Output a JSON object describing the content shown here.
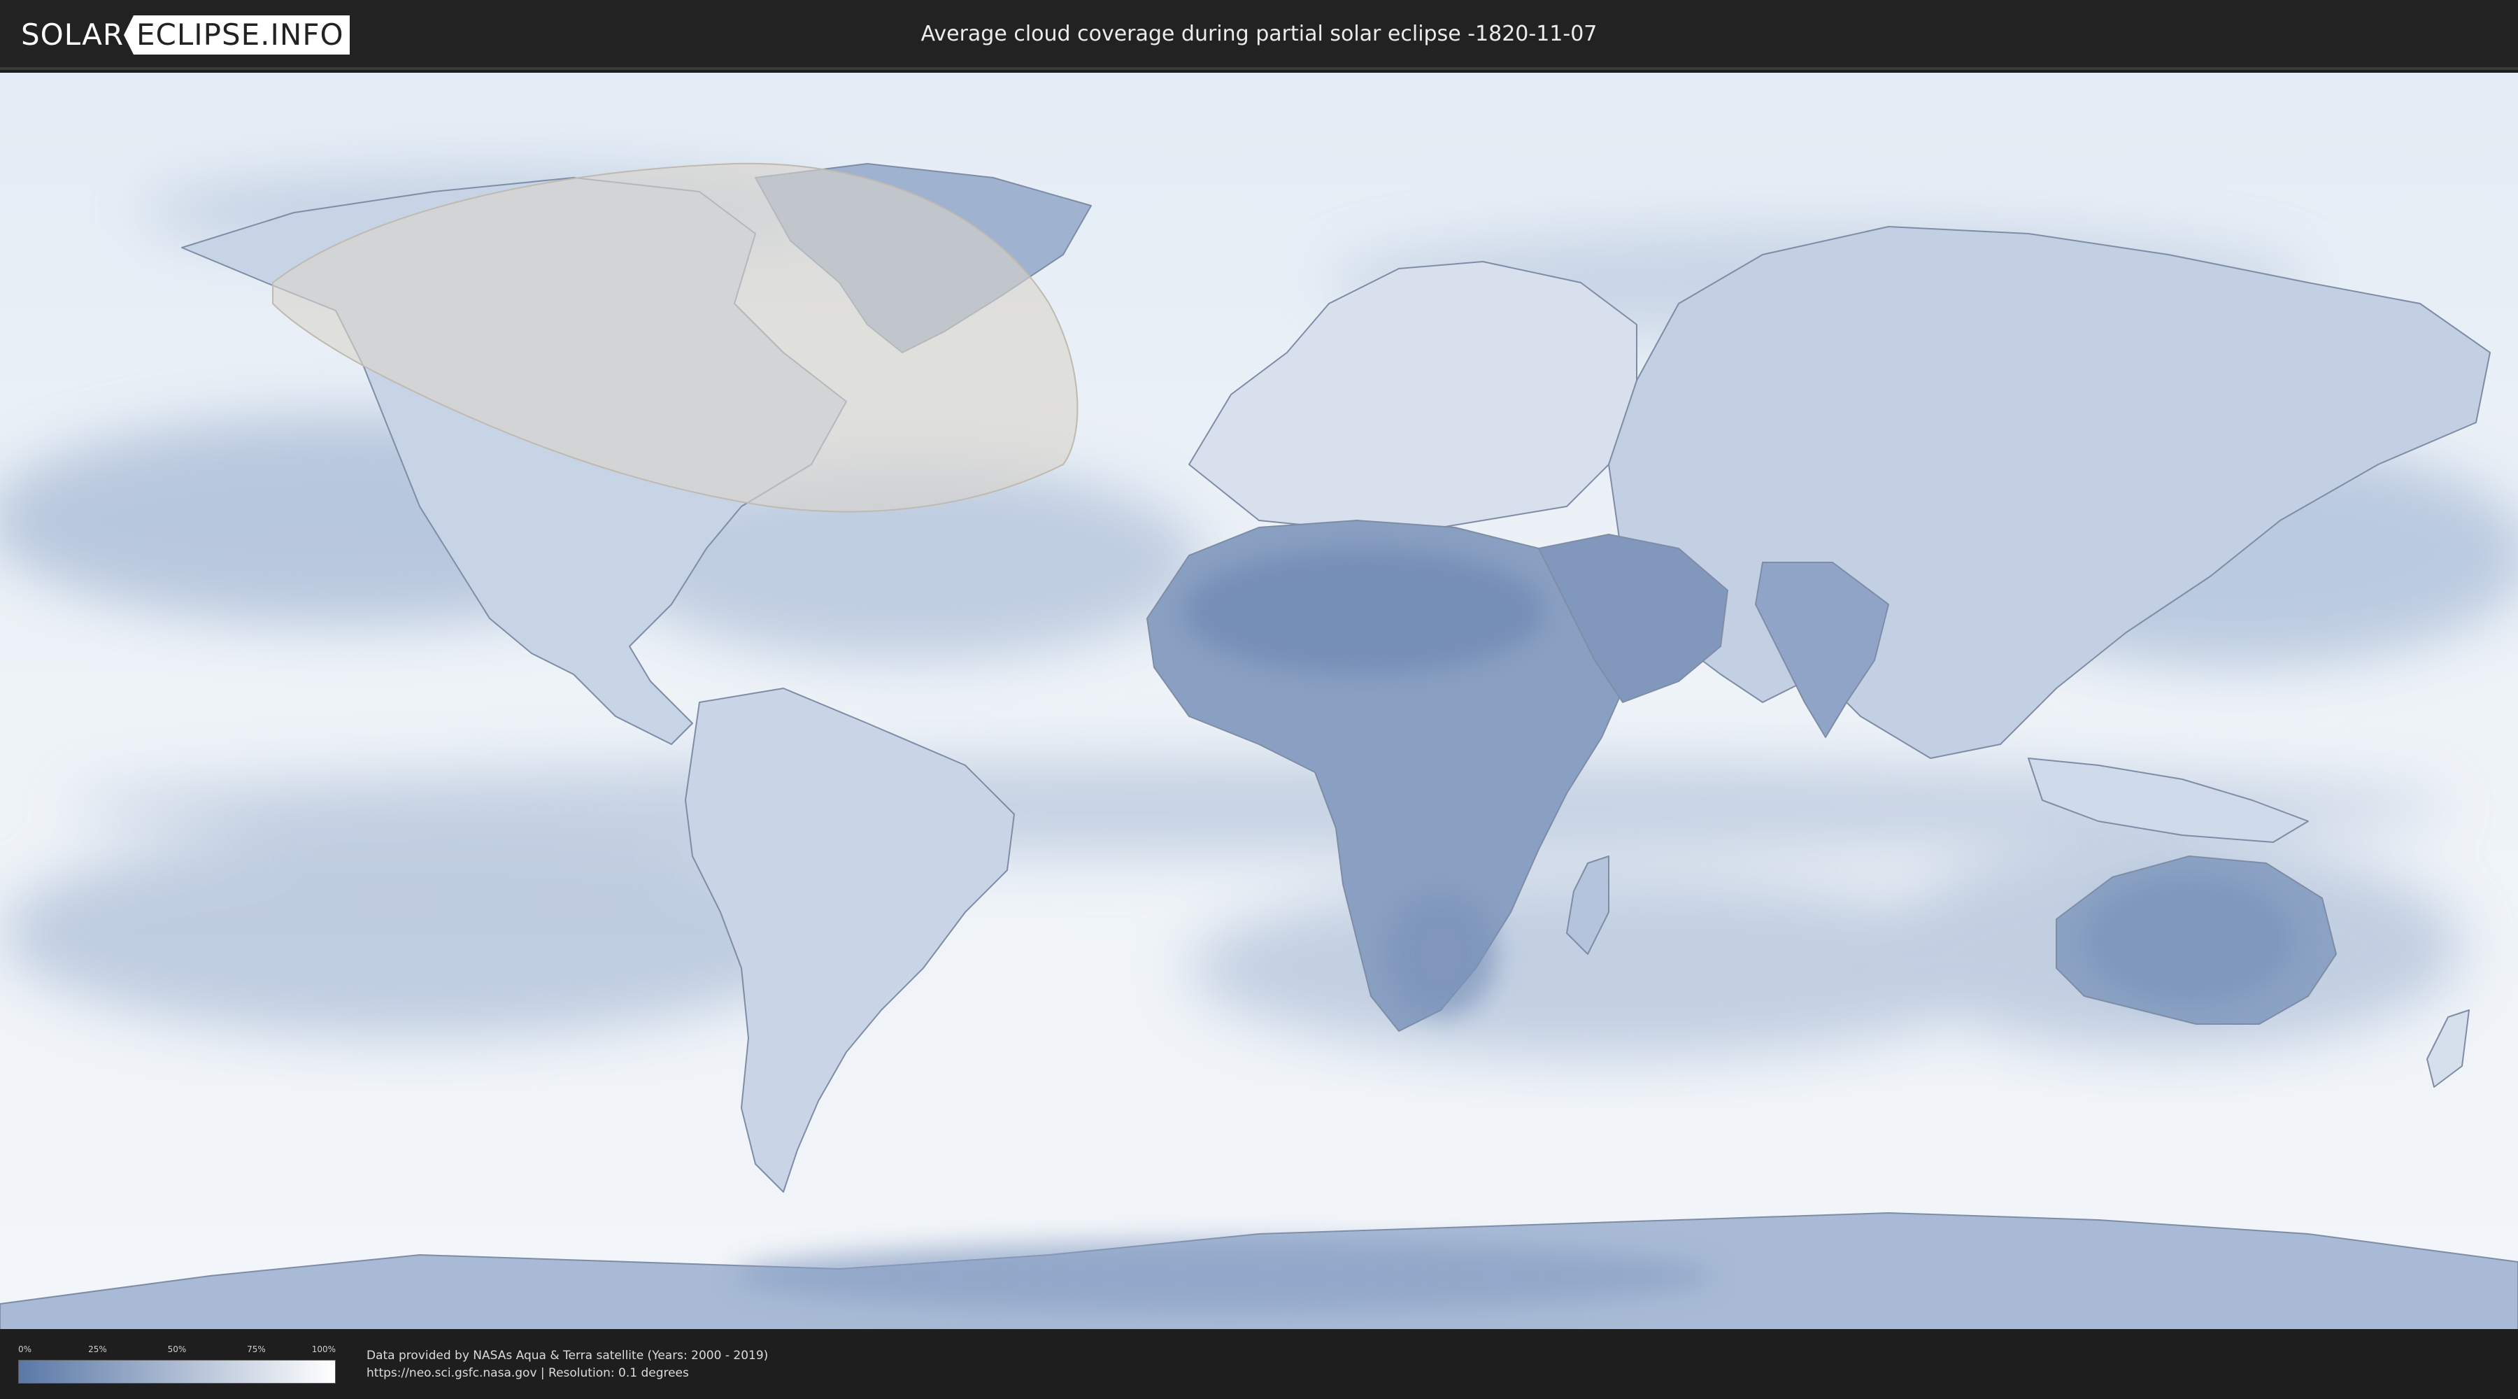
{
  "header": {
    "logo_left": "SOLAR",
    "logo_right": "ECLIPSE.INFO",
    "title": "Average cloud coverage during partial solar eclipse -1820-11-07"
  },
  "map": {
    "cloud_color_clear": "#5a78a6",
    "cloud_color_overcast": "#ffffff",
    "eclipse_overlay_color": "#d9d4cc",
    "land_outline_color": "#8290a8"
  },
  "legend": {
    "ticks": [
      "0%",
      "25%",
      "50%",
      "75%",
      "100%"
    ],
    "tick_fractions": [
      0,
      0.25,
      0.5,
      0.75,
      1
    ]
  },
  "footer": {
    "line1": "Data provided by NASAs Aqua & Terra satellite (Years: 2000 - 2019)",
    "line2": "https://neo.sci.gsfc.nasa.gov | Resolution: 0.1 degrees"
  }
}
